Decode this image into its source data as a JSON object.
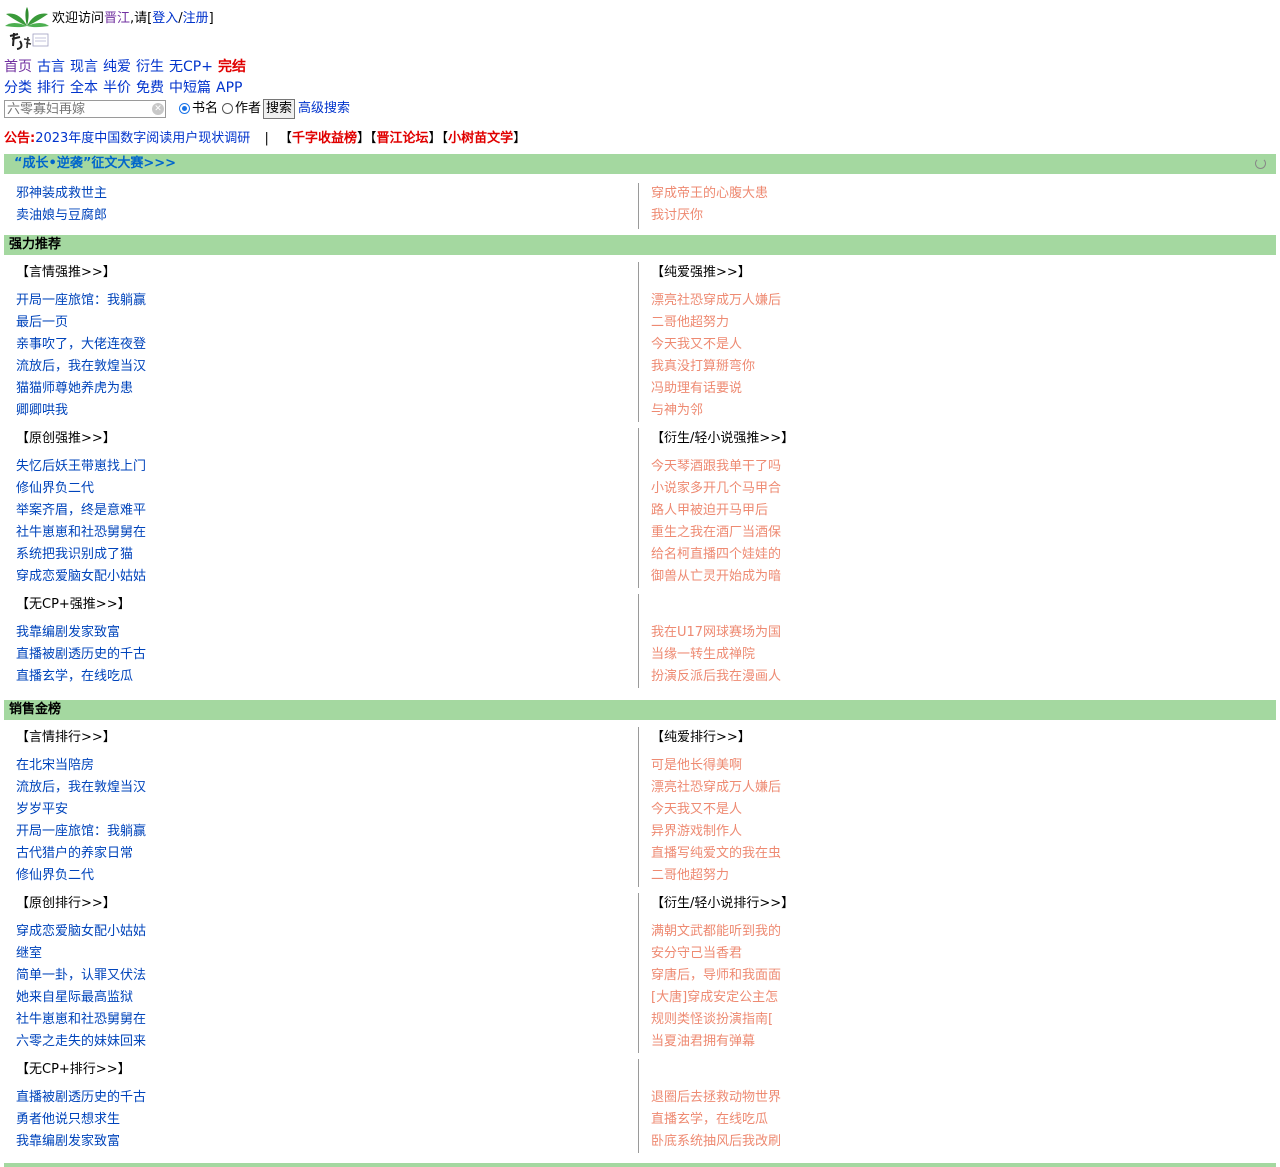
{
  "header": {
    "welcome_prefix": "欢迎访问",
    "site_name": "晋江",
    "welcome_mid": ",请[",
    "login": "登入",
    "slash": "/",
    "register": "注册",
    "welcome_suffix": "]",
    "logo": "jinjiang-logo"
  },
  "nav": {
    "row1": [
      "首页",
      "古言",
      "现言",
      "纯爱",
      "衍生",
      "无CP+",
      "完结"
    ],
    "row2": [
      "分类",
      "排行",
      "全本",
      "半价",
      "免费",
      "中短篇",
      "APP"
    ]
  },
  "search": {
    "placeholder": "六零寡妇再嫁",
    "option_book": "书名",
    "option_author": "作者",
    "button": "搜索",
    "advanced": "高级搜索"
  },
  "notice": {
    "label": "公告:",
    "text": "2023年度中国数字阅读用户现状调研",
    "sep": "|",
    "links": [
      "千字收益榜",
      "晋江论坛",
      "小树苗文学"
    ]
  },
  "contest": {
    "title": "“成长•逆袭”征文大赛>>>",
    "left": [
      "邪神装成救世主",
      "卖油娘与豆腐郎"
    ],
    "right": [
      "穿成帝王的心腹大患",
      "我讨厌你"
    ]
  },
  "recommend": {
    "title": "强力推荐",
    "blocks": [
      {
        "left_title": "【言情强推>>】",
        "right_title": "【纯爱强推>>】",
        "left": [
          "开局一座旅馆：我躺赢",
          "最后一页",
          "亲事吹了，大佬连夜登",
          "流放后，我在敦煌当汉",
          "猫猫师尊她养虎为患",
          "卿卿哄我"
        ],
        "right": [
          "漂亮社恐穿成万人嫌后",
          "二哥他超努力",
          "今天我又不是人",
          "我真没打算掰弯你",
          "冯助理有话要说",
          "与神为邻"
        ]
      },
      {
        "left_title": "【原创强推>>】",
        "right_title": "【衍生/轻小说强推>>】",
        "left": [
          "失忆后妖王带崽找上门",
          "修仙界负二代",
          "举案齐眉，终是意难平",
          "社牛崽崽和社恐舅舅在",
          "系统把我识别成了猫",
          "穿成恋爱脑女配小姑姑"
        ],
        "right": [
          "今天琴酒跟我单干了吗",
          "小说家多开几个马甲合",
          "路人甲被迫开马甲后",
          "重生之我在酒厂当酒保",
          "给名柯直播四个娃娃的",
          "御兽从亡灵开始成为暗"
        ]
      },
      {
        "left_title": "【无CP+强推>>】",
        "right_title": "",
        "left": [
          "我靠编剧发家致富",
          "直播被剧透历史的千古",
          "直播玄学，在线吃瓜"
        ],
        "right": [
          "我在U17网球赛场为国",
          "当缘一转生成禅院",
          "扮演反派后我在漫画人"
        ]
      }
    ]
  },
  "sales": {
    "title": "销售金榜",
    "blocks": [
      {
        "left_title": "【言情排行>>】",
        "right_title": "【纯爱排行>>】",
        "left": [
          "在北宋当陪房",
          "流放后，我在敦煌当汉",
          "岁岁平安",
          "开局一座旅馆：我躺赢",
          "古代猎户的养家日常",
          "修仙界负二代"
        ],
        "right": [
          "可是他长得美啊",
          "漂亮社恐穿成万人嫌后",
          "今天我又不是人",
          "异界游戏制作人",
          "直播写纯爱文的我在虫",
          "二哥他超努力"
        ]
      },
      {
        "left_title": "【原创排行>>】",
        "right_title": "【衍生/轻小说排行>>】",
        "left": [
          "穿成恋爱脑女配小姑姑",
          "继室",
          "简单一卦，认罪又伏法",
          "她来自星际最高监狱",
          "社牛崽崽和社恐舅舅在",
          "六零之走失的妹妹回来"
        ],
        "right": [
          "满朝文武都能听到我的",
          "安分守己当香君",
          "穿唐后，导师和我面面",
          "[大唐]穿成安定公主怎",
          "规则类怪谈扮演指南[",
          "当夏油君拥有弹幕"
        ]
      },
      {
        "left_title": "【无CP+排行>>】",
        "right_title": "",
        "left": [
          "直播被剧透历史的千古",
          "勇者他说只想求生",
          "我靠编剧发家致富"
        ],
        "right": [
          "退圈后去拯救动物世界",
          "直播玄学，在线吃瓜",
          "卧底系统抽风后我改刷"
        ]
      }
    ]
  }
}
